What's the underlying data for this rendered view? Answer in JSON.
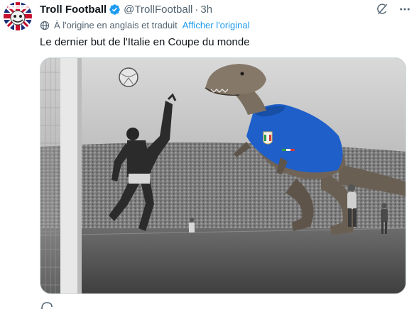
{
  "author": {
    "display_name": "Troll Football",
    "handle": "@TrollFootball",
    "separator": "·",
    "time": "3h"
  },
  "translation": {
    "note": "À l'origine en anglais et traduit",
    "show_original": "Afficher l'original"
  },
  "tweet": {
    "text": "Le dernier but de l'Italie en Coupe du monde"
  },
  "media": {
    "kind": "photo"
  },
  "icons": {
    "verified": "verified-badge-icon",
    "grok": "grok-icon",
    "more": "more-icon",
    "translate": "globe-icon"
  },
  "colors": {
    "accent": "#1d9bf0",
    "text": "#0f1419",
    "secondary": "#536471",
    "shirt": "#1f5fc9"
  }
}
